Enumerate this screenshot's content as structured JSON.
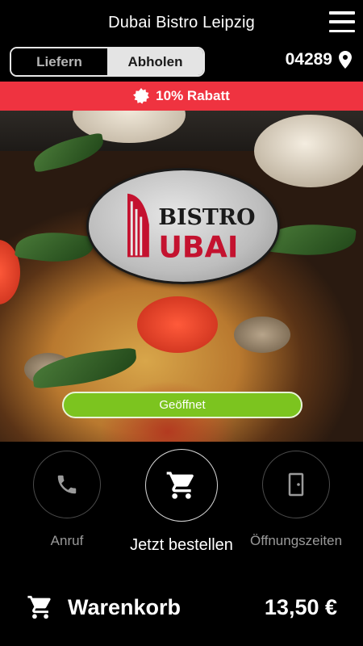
{
  "header": {
    "title": "Dubai Bistro Leipzig",
    "menu_icon": "hamburger-menu-icon"
  },
  "delivery_mode": {
    "options": [
      "Liefern",
      "Abholen"
    ],
    "selected": "Abholen"
  },
  "location": {
    "zip": "04289",
    "icon": "location-pin-icon"
  },
  "promo": {
    "text": "10% Rabatt",
    "icon": "discount-badge-icon",
    "color": "#ef3340"
  },
  "restaurant": {
    "logo_text_top": "BISTRO",
    "logo_text_bottom": "UBAI"
  },
  "status": {
    "label": "Geöffnet",
    "color": "#7cc41f"
  },
  "actions": [
    {
      "label": "Anruf",
      "icon": "phone-icon"
    },
    {
      "label": "Jetzt bestellen",
      "icon": "shopping-cart-icon"
    },
    {
      "label": "Öffnungszeiten",
      "icon": "door-icon"
    }
  ],
  "cart": {
    "label": "Warenkorb",
    "total": "13,50 €",
    "icon": "shopping-cart-icon"
  }
}
